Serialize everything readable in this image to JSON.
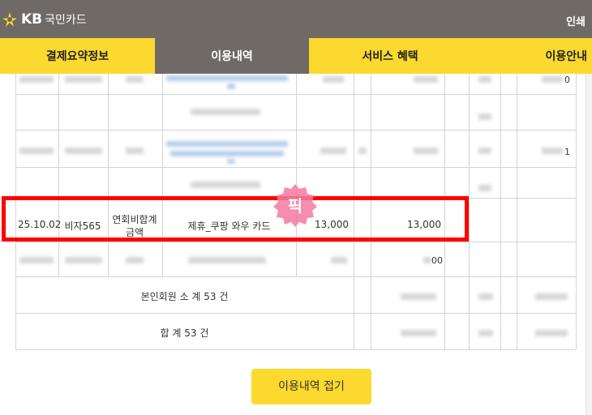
{
  "header": {
    "brand_kb": "KB",
    "brand_name": "국민카드",
    "print_label": "인쇄"
  },
  "tabs": [
    {
      "label": "결제요약정보"
    },
    {
      "label": "이용내역"
    },
    {
      "label": "서비스 혜택"
    },
    {
      "label": "이용안내"
    }
  ],
  "highlighted_row": {
    "date": "25.10.02",
    "card": "비자565",
    "type_line1": "연회비합계",
    "type_line2": "금액",
    "merchant": "제휴_쿠팡 와우 카드",
    "amount": "13,000",
    "payment": "13,000"
  },
  "partial_values": {
    "row1_last": "0",
    "row3_last": "1",
    "row6_payment": "00"
  },
  "summary": {
    "subtotal_label": "본인회원 소 계 53 건",
    "total_label": "합 계 53 건"
  },
  "stamp_text": "픽",
  "collapse_button": "이용내역 접기",
  "colors": {
    "header": "#6f6a66",
    "tab_bar": "#fcd92e",
    "highlight": "#ff0000",
    "stamp": "#f37aa0"
  }
}
